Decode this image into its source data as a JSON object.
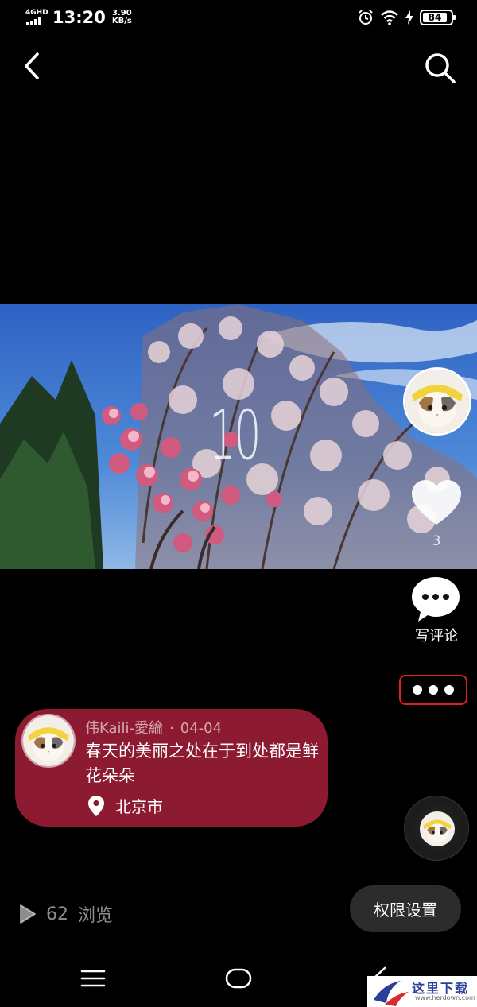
{
  "status_bar": {
    "network": "4GHD",
    "time": "13:20",
    "speed_value": "3.90",
    "speed_unit": "KB/s",
    "battery": "84",
    "icons": [
      "alarm-icon",
      "wifi-icon",
      "charging-icon",
      "battery-icon"
    ]
  },
  "nav": {
    "back_icon": "chevron-left-icon",
    "search_icon": "search-icon"
  },
  "photo": {
    "counter": "10"
  },
  "actions": {
    "like_count": "3",
    "comment_label": "写评论",
    "more_icon": "more-dots-icon"
  },
  "post": {
    "author": "伟Kaili-愛綸",
    "dot": "·",
    "date": "04-04",
    "text": "春天的美丽之处在于到处都是鲜花朵朵",
    "location": "北京市",
    "card_color": "#8c1a31"
  },
  "footer": {
    "views_count": "62",
    "views_label": "浏览",
    "permission_button": "权限设置"
  },
  "watermark": {
    "text": "这里下载",
    "url": "www.herdown.com"
  }
}
